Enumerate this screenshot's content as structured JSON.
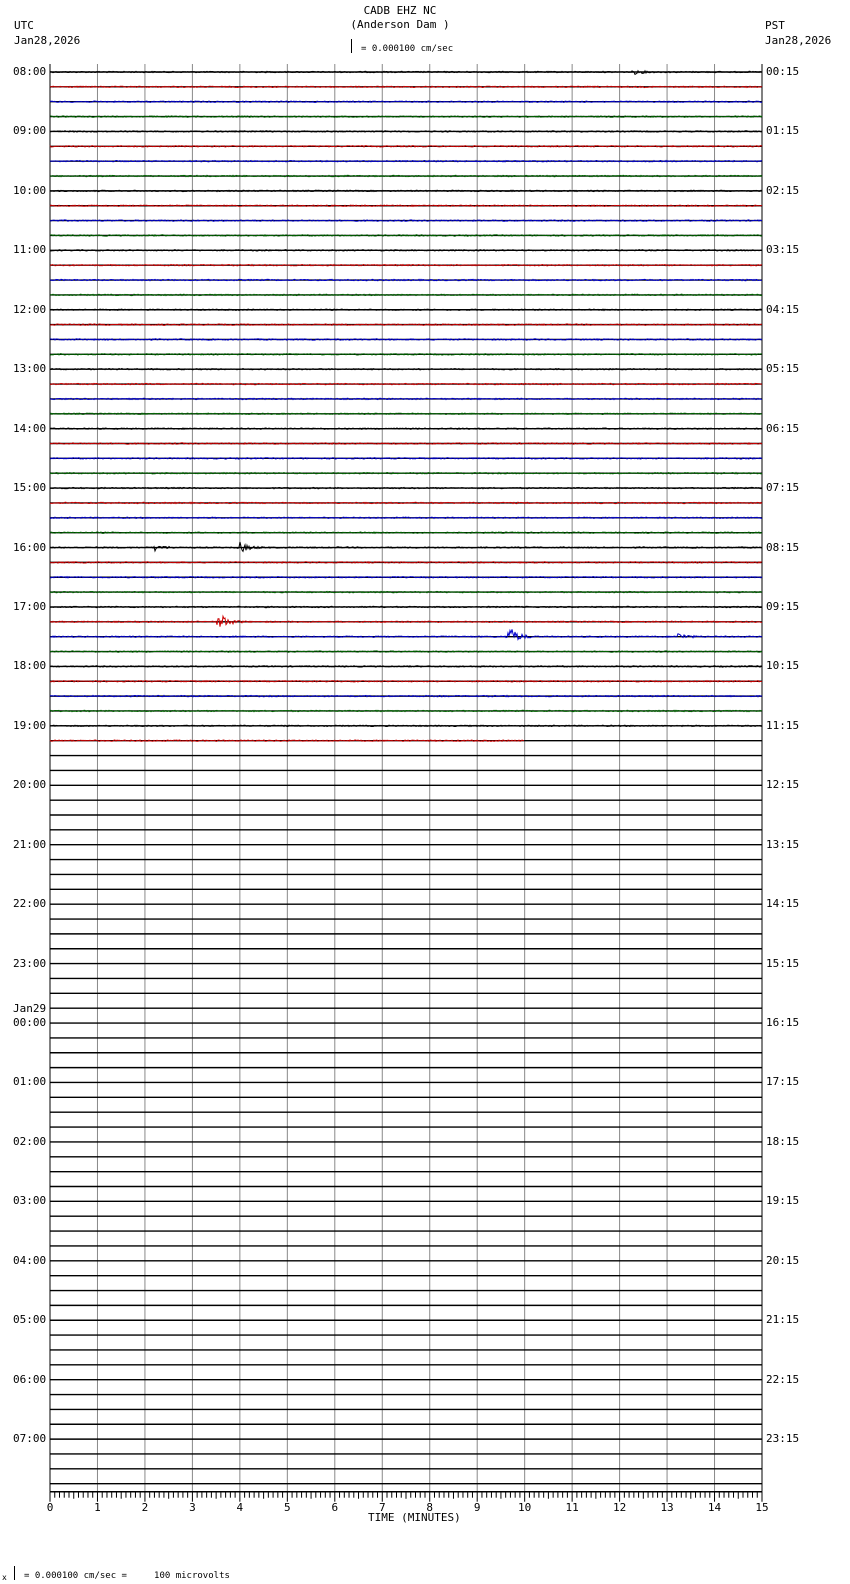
{
  "header": {
    "station": "CADB EHZ NC",
    "location": "(Anderson Dam )",
    "scale_text": "= 0.000100 cm/sec",
    "left_tz": "UTC",
    "left_date": "Jan28,2026",
    "right_tz": "PST",
    "right_date": "Jan28,2026"
  },
  "footer": {
    "scale_prefix": "x",
    "scale_text": "= 0.000100 cm/sec =     100 microvolts"
  },
  "chart_data": {
    "type": "line",
    "title": "CADB EHZ NC (Anderson Dam )",
    "xlabel": "TIME (MINUTES)",
    "xlim": [
      0,
      15
    ],
    "x_ticks": [
      "0",
      "1",
      "2",
      "3",
      "4",
      "5",
      "6",
      "7",
      "8",
      "9",
      "10",
      "11",
      "12",
      "13",
      "14",
      "15"
    ],
    "traces_per_hour": 4,
    "total_traces": 96,
    "traces_with_data": 46,
    "last_trace_end_minute": 10,
    "trace_colors": [
      "#000000",
      "#cc0000",
      "#0000cc",
      "#006600"
    ],
    "left_labels": [
      {
        "row": 0,
        "text": "08:00"
      },
      {
        "row": 4,
        "text": "09:00"
      },
      {
        "row": 8,
        "text": "10:00"
      },
      {
        "row": 12,
        "text": "11:00"
      },
      {
        "row": 16,
        "text": "12:00"
      },
      {
        "row": 20,
        "text": "13:00"
      },
      {
        "row": 24,
        "text": "14:00"
      },
      {
        "row": 28,
        "text": "15:00"
      },
      {
        "row": 32,
        "text": "16:00"
      },
      {
        "row": 36,
        "text": "17:00"
      },
      {
        "row": 40,
        "text": "18:00"
      },
      {
        "row": 44,
        "text": "19:00"
      },
      {
        "row": 48,
        "text": "20:00"
      },
      {
        "row": 52,
        "text": "21:00"
      },
      {
        "row": 56,
        "text": "22:00"
      },
      {
        "row": 60,
        "text": "23:00"
      },
      {
        "row": 64,
        "text": "00:00",
        "date": "Jan29"
      },
      {
        "row": 68,
        "text": "01:00"
      },
      {
        "row": 72,
        "text": "02:00"
      },
      {
        "row": 76,
        "text": "03:00"
      },
      {
        "row": 80,
        "text": "04:00"
      },
      {
        "row": 84,
        "text": "05:00"
      },
      {
        "row": 88,
        "text": "06:00"
      },
      {
        "row": 92,
        "text": "07:00"
      }
    ],
    "right_labels": [
      "00:15",
      "01:15",
      "02:15",
      "03:15",
      "04:15",
      "05:15",
      "06:15",
      "07:15",
      "08:15",
      "09:15",
      "10:15",
      "11:15",
      "12:15",
      "13:15",
      "14:15",
      "15:15",
      "16:15",
      "17:15",
      "18:15",
      "19:15",
      "20:15",
      "21:15",
      "22:15",
      "23:15"
    ],
    "events": [
      {
        "row": 0,
        "minute": 12.3,
        "amplitude": 2
      },
      {
        "row": 32,
        "minute": 2.2,
        "amplitude": 3
      },
      {
        "row": 32,
        "minute": 4.0,
        "amplitude": 5
      },
      {
        "row": 37,
        "minute": 3.55,
        "amplitude": 9
      },
      {
        "row": 38,
        "minute": 9.65,
        "amplitude": 11
      },
      {
        "row": 38,
        "minute": 13.2,
        "amplitude": 4
      }
    ]
  }
}
